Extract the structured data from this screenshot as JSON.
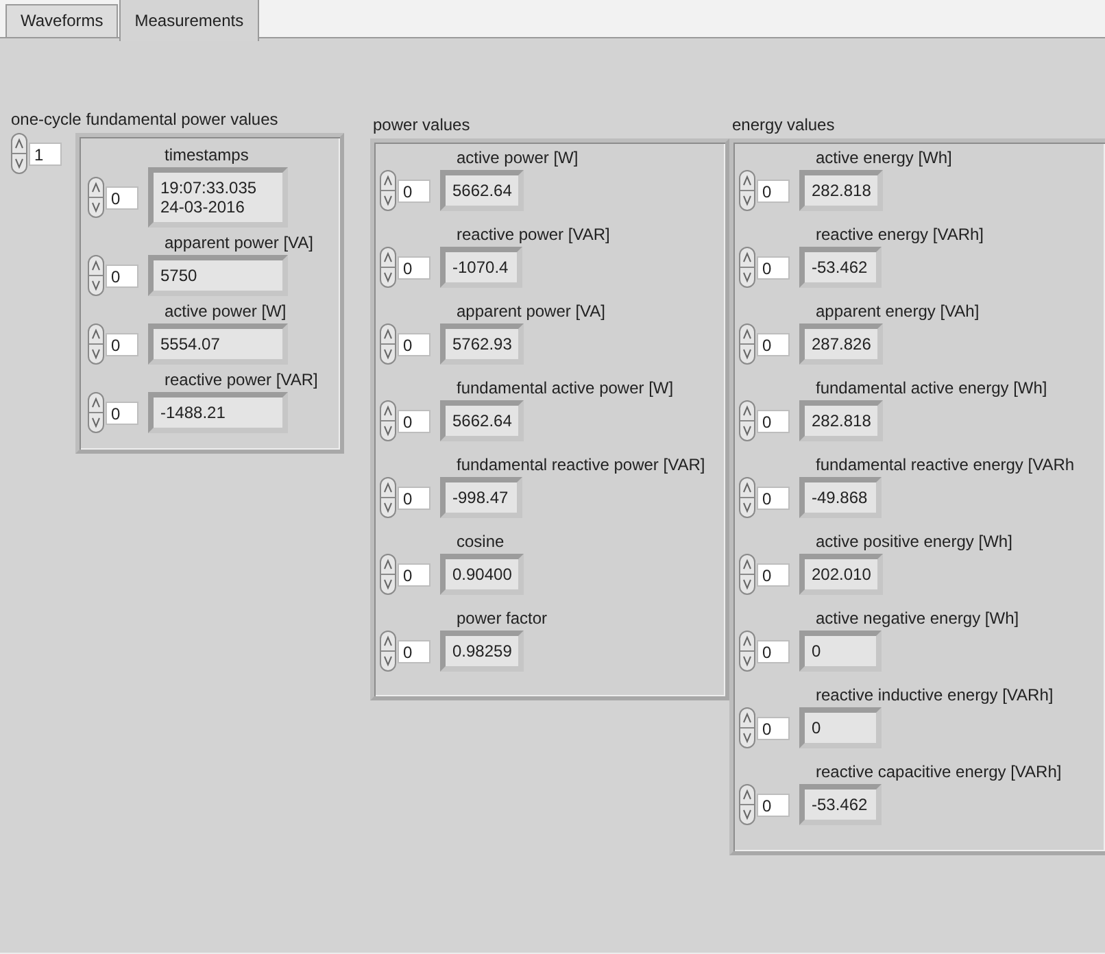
{
  "tabs": [
    {
      "label": "Waveforms",
      "selected": false
    },
    {
      "label": "Measurements",
      "selected": true
    }
  ],
  "groups": [
    {
      "kind": "array",
      "label": "one-cycle fundamental power values",
      "index": "1",
      "items": [
        {
          "label": "timestamps",
          "index": "0",
          "value": "19:07:33.035\n24-03-2016"
        },
        {
          "label": "apparent power [VA]",
          "index": "0",
          "value": "5750"
        },
        {
          "label": "active power [W]",
          "index": "0",
          "value": "5554.07"
        },
        {
          "label": "reactive power [VAR]",
          "index": "0",
          "value": "-1488.21"
        }
      ]
    },
    {
      "kind": "cluster",
      "label": "power values",
      "items": [
        {
          "label": "active power [W]",
          "index": "0",
          "value": "5662.64"
        },
        {
          "label": "reactive power [VAR]",
          "index": "0",
          "value": "-1070.4"
        },
        {
          "label": "apparent power [VA]",
          "index": "0",
          "value": "5762.93"
        },
        {
          "label": "fundamental active power [W]",
          "index": "0",
          "value": "5662.64"
        },
        {
          "label": "fundamental reactive power [VAR]",
          "index": "0",
          "value": "-998.47"
        },
        {
          "label": "cosine",
          "index": "0",
          "value": "0.90400"
        },
        {
          "label": "power factor",
          "index": "0",
          "value": "0.98259"
        }
      ]
    },
    {
      "kind": "cluster",
      "label": "energy values",
      "items": [
        {
          "label": "active energy [Wh]",
          "index": "0",
          "value": "282.818"
        },
        {
          "label": "reactive energy [VARh]",
          "index": "0",
          "value": "-53.462"
        },
        {
          "label": "apparent energy [VAh]",
          "index": "0",
          "value": "287.826"
        },
        {
          "label": "fundamental active energy [Wh]",
          "index": "0",
          "value": "282.818"
        },
        {
          "label": "fundamental reactive energy [VARh",
          "index": "0",
          "value": "-49.868"
        },
        {
          "label": "active positive energy [Wh]",
          "index": "0",
          "value": "202.010"
        },
        {
          "label": "active negative energy [Wh]",
          "index": "0",
          "value": "0"
        },
        {
          "label": "reactive inductive energy [VARh]",
          "index": "0",
          "value": "0"
        },
        {
          "label": "reactive capacitive energy [VARh]",
          "index": "0",
          "value": "-53.462"
        }
      ]
    }
  ]
}
